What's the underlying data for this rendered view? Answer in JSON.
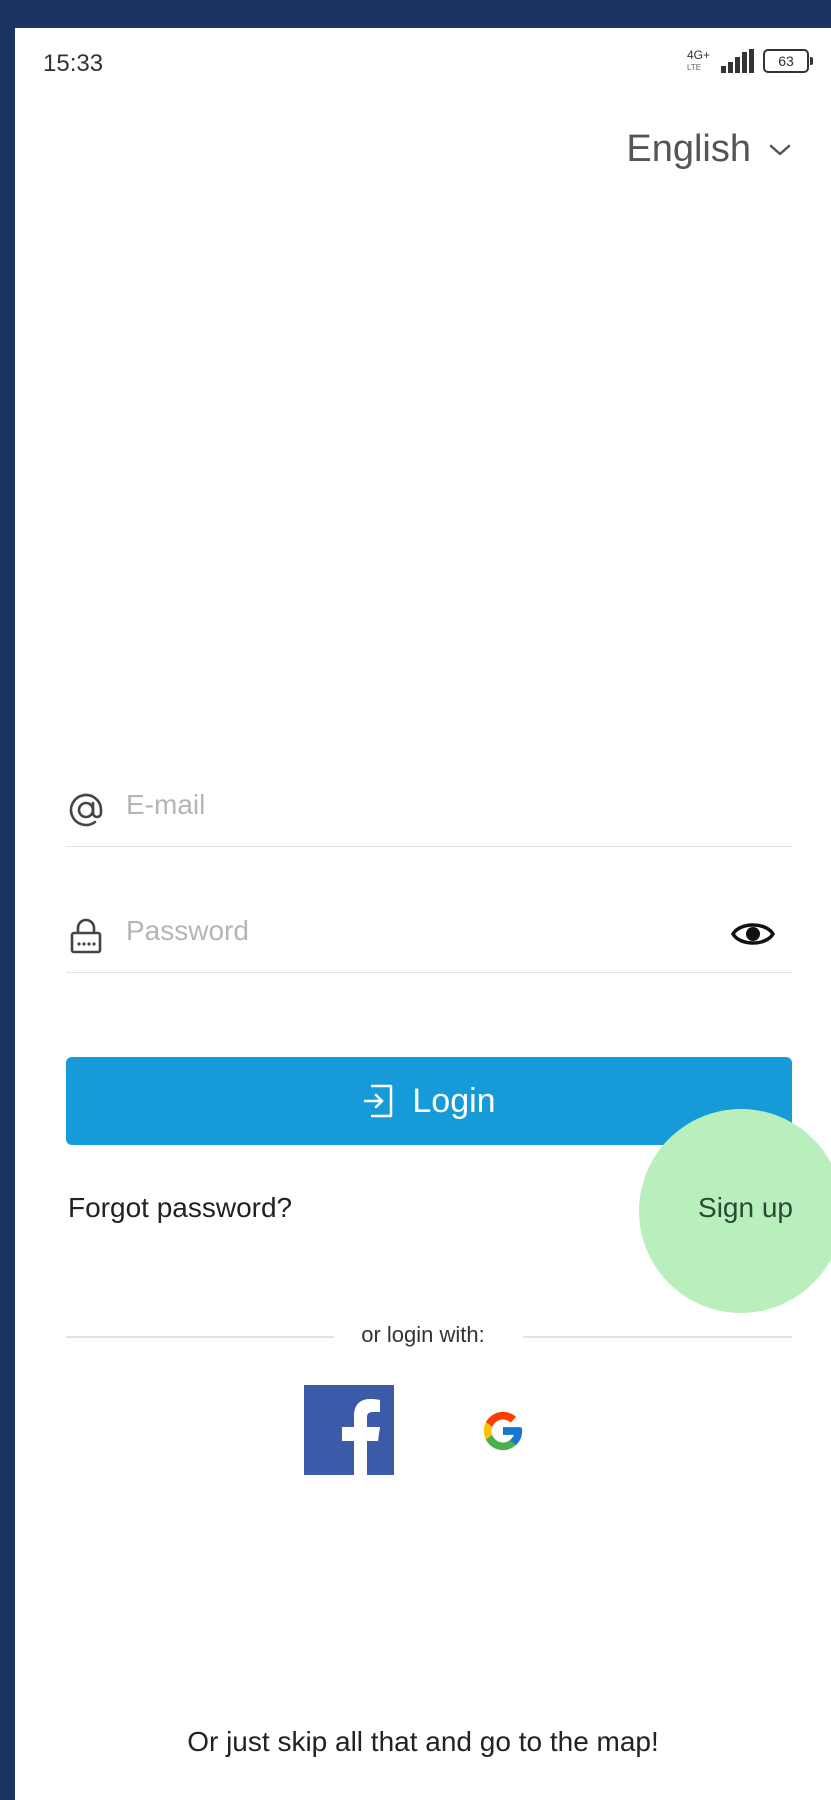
{
  "status_bar": {
    "time": "15:33",
    "network": "4G+",
    "network_sub": "LTE",
    "battery": "63"
  },
  "language_selector": {
    "label": "English"
  },
  "email": {
    "placeholder": "E-mail",
    "value": ""
  },
  "password": {
    "placeholder": "Password",
    "value": ""
  },
  "login_button": {
    "label": "Login"
  },
  "forgot_password": "Forgot password?",
  "sign_up": "Sign up",
  "social": {
    "label": "or login with:",
    "providers": [
      "facebook-icon",
      "google-icon"
    ]
  },
  "skip_link": "Or just skip all that and go to the map!",
  "colors": {
    "frame": "#1c3461",
    "primary": "#179ad8",
    "ripple": "#b8efbd",
    "facebook": "#3b5ba8"
  }
}
